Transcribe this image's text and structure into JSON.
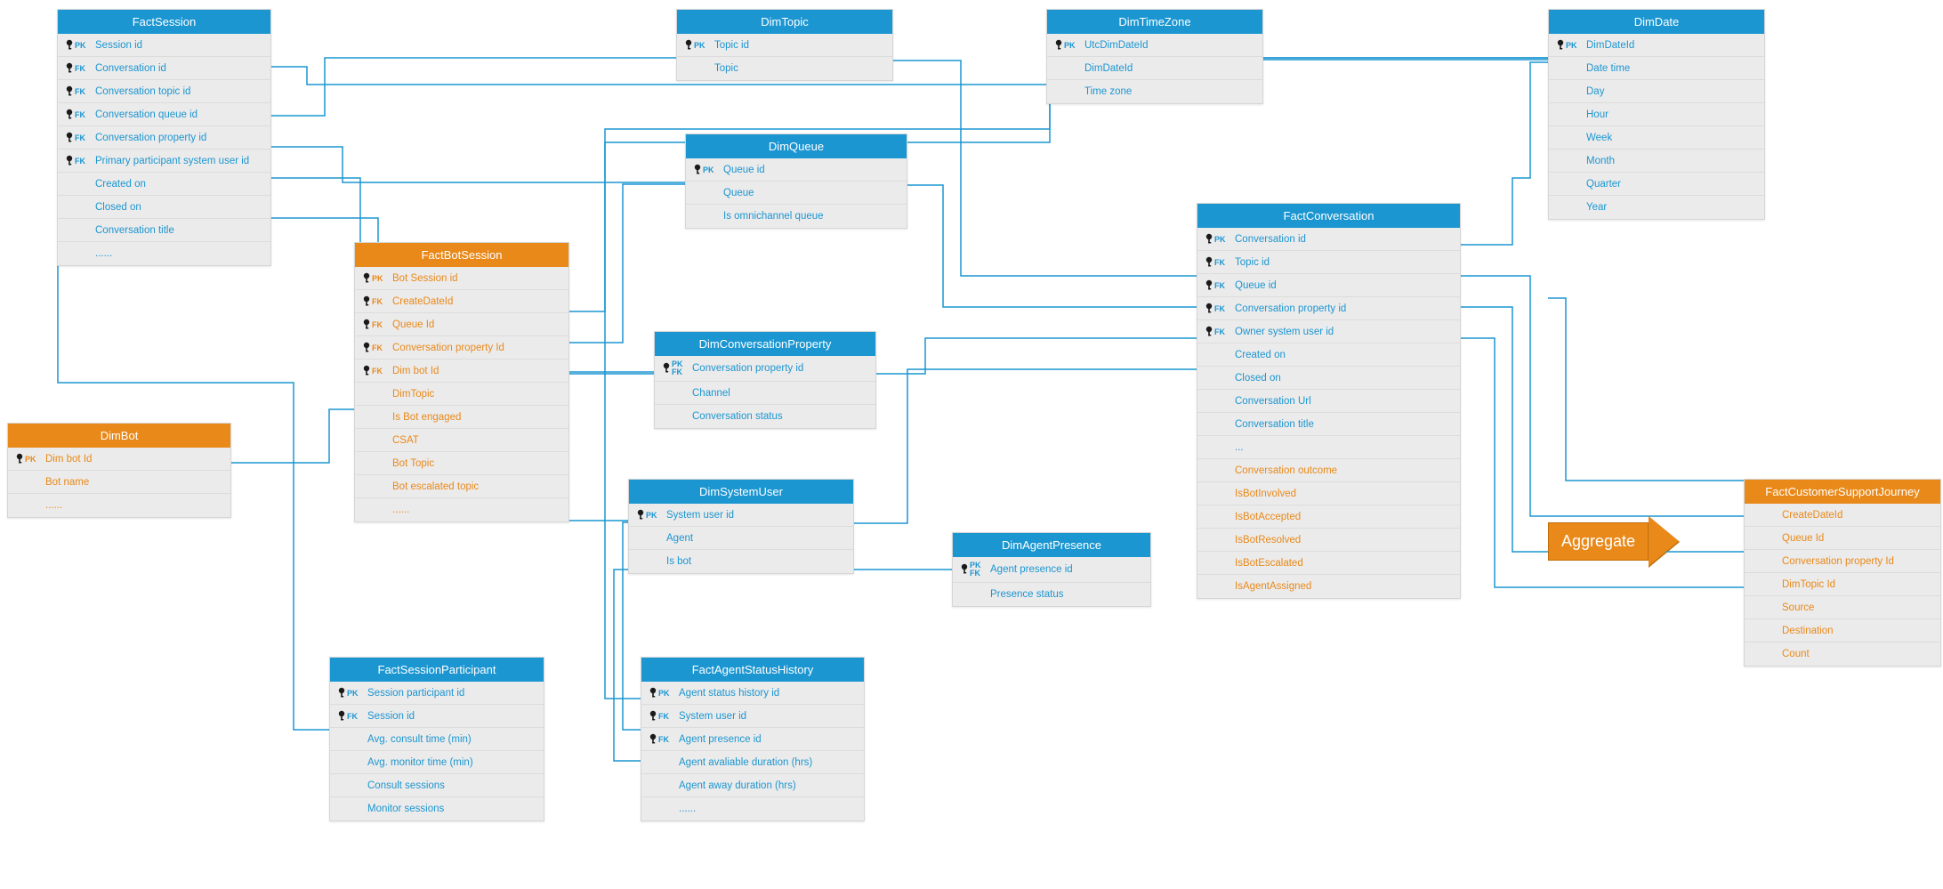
{
  "entities": {
    "factSession": {
      "title": "FactSession",
      "rows": [
        {
          "key": "PK",
          "label": "Session id"
        },
        {
          "key": "FK",
          "label": "Conversation id"
        },
        {
          "key": "FK",
          "label": "Conversation topic id"
        },
        {
          "key": "FK",
          "label": "Conversation queue id"
        },
        {
          "key": "FK",
          "label": "Conversation property id"
        },
        {
          "key": "FK",
          "label": "Primary participant system user id"
        },
        {
          "key": "",
          "label": "Created on"
        },
        {
          "key": "",
          "label": "Closed on"
        },
        {
          "key": "",
          "label": "Conversation title"
        },
        {
          "key": "",
          "label": "......"
        }
      ]
    },
    "dimBot": {
      "title": "DimBot",
      "rows": [
        {
          "key": "PK",
          "label": "Dim bot Id"
        },
        {
          "key": "",
          "label": "Bot name"
        },
        {
          "key": "",
          "label": "......"
        }
      ]
    },
    "factBotSession": {
      "title": "FactBotSession",
      "rows": [
        {
          "key": "PK",
          "label": "Bot Session id"
        },
        {
          "key": "FK",
          "label": "CreateDateId"
        },
        {
          "key": "FK",
          "label": "Queue Id"
        },
        {
          "key": "FK",
          "label": "Conversation property Id"
        },
        {
          "key": "FK",
          "label": "Dim bot Id"
        },
        {
          "key": "",
          "label": "DimTopic"
        },
        {
          "key": "",
          "label": "Is Bot engaged"
        },
        {
          "key": "",
          "label": "CSAT"
        },
        {
          "key": "",
          "label": "Bot Topic"
        },
        {
          "key": "",
          "label": "Bot escalated topic"
        },
        {
          "key": "",
          "label": "......"
        }
      ]
    },
    "factSessionParticipant": {
      "title": "FactSessionParticipant",
      "rows": [
        {
          "key": "PK",
          "label": "Session participant id"
        },
        {
          "key": "FK",
          "label": "Session id"
        },
        {
          "key": "",
          "label": "Avg. consult time (min)"
        },
        {
          "key": "",
          "label": "Avg. monitor time (min)"
        },
        {
          "key": "",
          "label": "Consult sessions"
        },
        {
          "key": "",
          "label": "Monitor sessions"
        }
      ]
    },
    "dimTopic": {
      "title": "DimTopic",
      "rows": [
        {
          "key": "PK",
          "label": "Topic id"
        },
        {
          "key": "",
          "label": "Topic"
        }
      ]
    },
    "dimQueue": {
      "title": "DimQueue",
      "rows": [
        {
          "key": "PK",
          "label": "Queue id"
        },
        {
          "key": "",
          "label": "Queue"
        },
        {
          "key": "",
          "label": "Is omnichannel queue"
        }
      ]
    },
    "dimConvProp": {
      "title": "DimConversationProperty",
      "rows": [
        {
          "key": "PKFK",
          "label": "Conversation property id"
        },
        {
          "key": "",
          "label": "Channel"
        },
        {
          "key": "",
          "label": "Conversation status"
        }
      ]
    },
    "dimSystemUser": {
      "title": "DimSystemUser",
      "rows": [
        {
          "key": "PK",
          "label": "System user id"
        },
        {
          "key": "",
          "label": "Agent"
        },
        {
          "key": "",
          "label": "Is bot"
        }
      ]
    },
    "factAgentStatusHistory": {
      "title": "FactAgentStatusHistory",
      "rows": [
        {
          "key": "PK",
          "label": "Agent status history id"
        },
        {
          "key": "FK",
          "label": "System user id"
        },
        {
          "key": "FK",
          "label": "Agent presence id"
        },
        {
          "key": "",
          "label": "Agent avaliable duration (hrs)"
        },
        {
          "key": "",
          "label": "Agent away duration (hrs)"
        },
        {
          "key": "",
          "label": "......"
        }
      ]
    },
    "dimTimeZone": {
      "title": "DimTimeZone",
      "rows": [
        {
          "key": "PK",
          "label": "UtcDimDateId"
        },
        {
          "key": "",
          "label": "DimDateId"
        },
        {
          "key": "",
          "label": "Time zone"
        }
      ]
    },
    "dimAgentPresence": {
      "title": "DimAgentPresence",
      "rows": [
        {
          "key": "PKFK",
          "label": "Agent presence id"
        },
        {
          "key": "",
          "label": "Presence status"
        }
      ]
    },
    "factConversation": {
      "title": "FactConversation",
      "rows": [
        {
          "key": "PK",
          "label": "Conversation id"
        },
        {
          "key": "FK",
          "label": "Topic id"
        },
        {
          "key": "FK",
          "label": "Queue id"
        },
        {
          "key": "FK",
          "label": "Conversation property id"
        },
        {
          "key": "FK",
          "label": "Owner system user id"
        },
        {
          "key": "",
          "label": "Created on"
        },
        {
          "key": "",
          "label": "Closed on"
        },
        {
          "key": "",
          "label": "Conversation Url"
        },
        {
          "key": "",
          "label": "Conversation title"
        },
        {
          "key": "",
          "label": "..."
        },
        {
          "key": "",
          "label": "Conversation outcome",
          "orange": true
        },
        {
          "key": "",
          "label": "IsBotInvolved",
          "orange": true
        },
        {
          "key": "",
          "label": "IsBotAccepted",
          "orange": true
        },
        {
          "key": "",
          "label": "IsBotResolved",
          "orange": true
        },
        {
          "key": "",
          "label": "IsBotEscalated",
          "orange": true
        },
        {
          "key": "",
          "label": "IsAgentAssigned",
          "orange": true
        }
      ]
    },
    "dimDate": {
      "title": "DimDate",
      "rows": [
        {
          "key": "PK",
          "label": "DimDateId"
        },
        {
          "key": "",
          "label": "Date time"
        },
        {
          "key": "",
          "label": "Day"
        },
        {
          "key": "",
          "label": "Hour"
        },
        {
          "key": "",
          "label": "Week"
        },
        {
          "key": "",
          "label": "Month"
        },
        {
          "key": "",
          "label": "Quarter"
        },
        {
          "key": "",
          "label": "Year"
        }
      ]
    },
    "factCustomerSupportJourney": {
      "title": "FactCustomerSupportJourney",
      "rows": [
        {
          "key": "",
          "label": "CreateDateId"
        },
        {
          "key": "",
          "label": "Queue Id"
        },
        {
          "key": "",
          "label": "Conversation property Id"
        },
        {
          "key": "",
          "label": "DimTopic Id"
        },
        {
          "key": "",
          "label": "Source"
        },
        {
          "key": "",
          "label": "Destination"
        },
        {
          "key": "",
          "label": "Count"
        }
      ]
    }
  },
  "aggregateLabel": "Aggregate",
  "colors": {
    "blue": "#1b96d1",
    "orange": "#e8891a"
  }
}
